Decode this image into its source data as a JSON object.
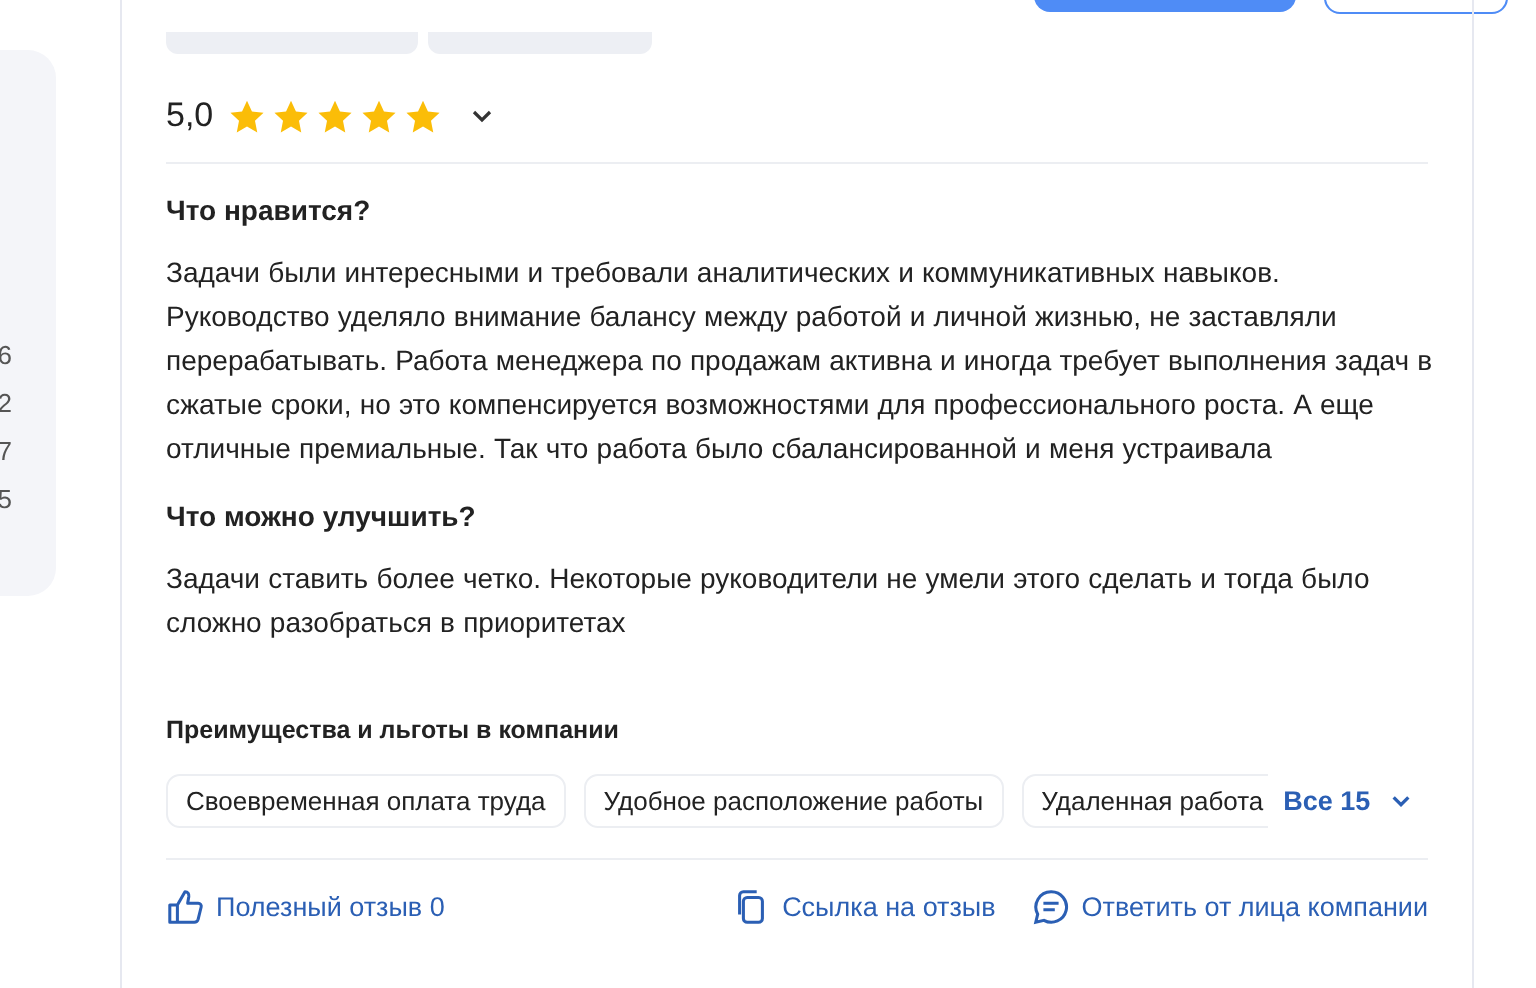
{
  "side_panel": {
    "numbers": [
      "6",
      "2",
      "7",
      "5"
    ]
  },
  "review": {
    "rating": "5,0",
    "stars": 5,
    "expanded": false,
    "sections": [
      {
        "title": "Что нравится?",
        "text": "Задачи были интересными и требовали аналитических и коммуникативных навыков. Руководство уделяло внимание балансу между работой и личной жизнью, не заставляли перерабатывать. Работа менеджера по продажам активна и иногда требует выполнения задач в сжатые сроки, но это компенсируется возможностями для профессионального роста. А еще отличные премиальные. Так что работа было сбалансированной и меня устраивала"
      },
      {
        "title": "Что можно улучшить?",
        "text": "Задачи ставить более четко. Некоторые руководители не умели этого сделать и тогда было сложно разобраться в приоритетах"
      }
    ],
    "benefits": {
      "title": "Преимущества и льготы в компании",
      "items": [
        "Своевременная оплата труда",
        "Удобное расположение работы",
        "Удаленная работа"
      ],
      "more": "Все 15"
    },
    "actions": [
      {
        "kind": "like",
        "label": "Полезный отзыв 0"
      },
      {
        "kind": "link",
        "label": "Ссылка на отзыв"
      },
      {
        "kind": "reply",
        "label": "Ответить от лица компании"
      }
    ]
  }
}
